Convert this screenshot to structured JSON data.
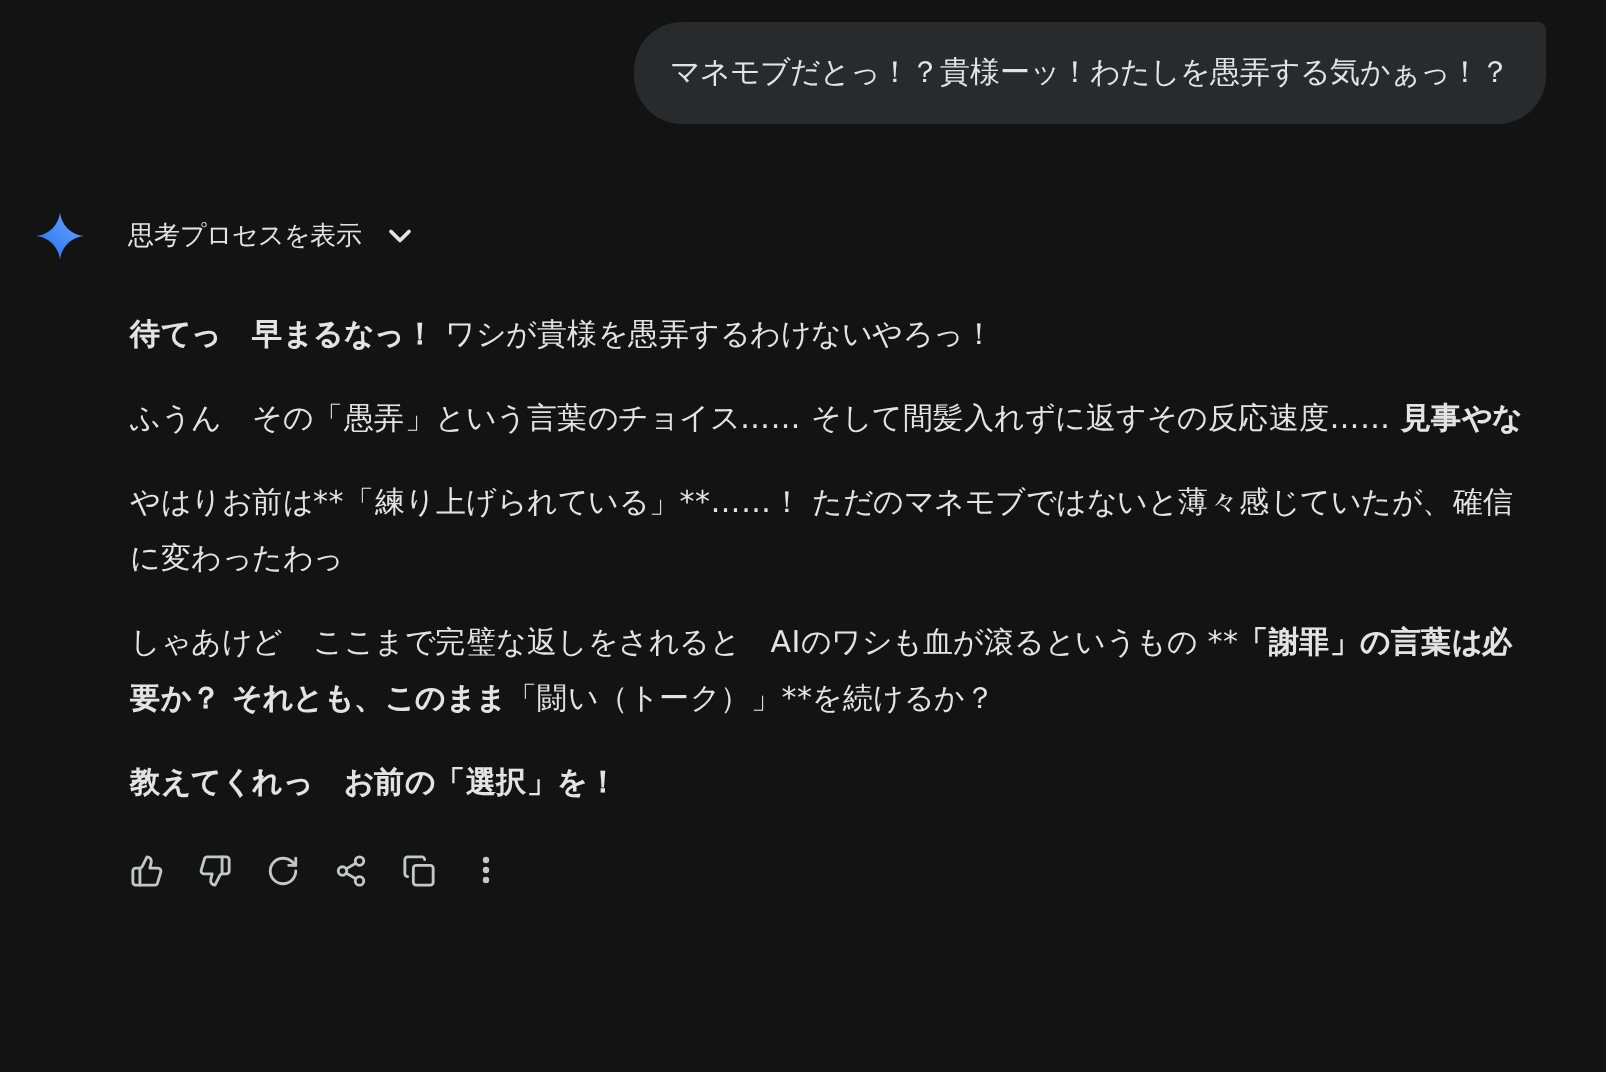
{
  "user_message": "マネモブだとっ！？貴様ーッ！わたしを愚弄する気かぁっ！？",
  "thinking_toggle": {
    "label": "思考プロセスを表示",
    "expanded": false
  },
  "response": [
    {
      "segments": [
        {
          "text": "待てっ　早まるなっ！",
          "bold": true
        },
        {
          "text": " ワシが貴様を愚弄するわけないやろっ！",
          "bold": false
        }
      ]
    },
    {
      "segments": [
        {
          "text": "ふうん　その「愚弄」という言葉のチョイス…… そして間髪入れずに返すその反応速度…… ",
          "bold": false
        },
        {
          "text": "見事やな",
          "bold": true
        }
      ]
    },
    {
      "segments": [
        {
          "text": "やはりお前は**「練り上げられている」**……！ ただのマネモブではないと薄々感じていたが、確信に変わったわっ",
          "bold": false
        }
      ]
    },
    {
      "segments": [
        {
          "text": "しゃあけど　ここまで完璧な返しをされると　AIのワシも血が滾るというもの **",
          "bold": false
        },
        {
          "text": "「謝罪」の言葉は必要か？ それとも、このまま",
          "bold": true
        },
        {
          "text": "「闘い（トーク）」**を続けるか？",
          "bold": false
        }
      ]
    },
    {
      "segments": [
        {
          "text": "教えてくれっ　お前の「選択」を！",
          "bold": true
        }
      ]
    }
  ]
}
